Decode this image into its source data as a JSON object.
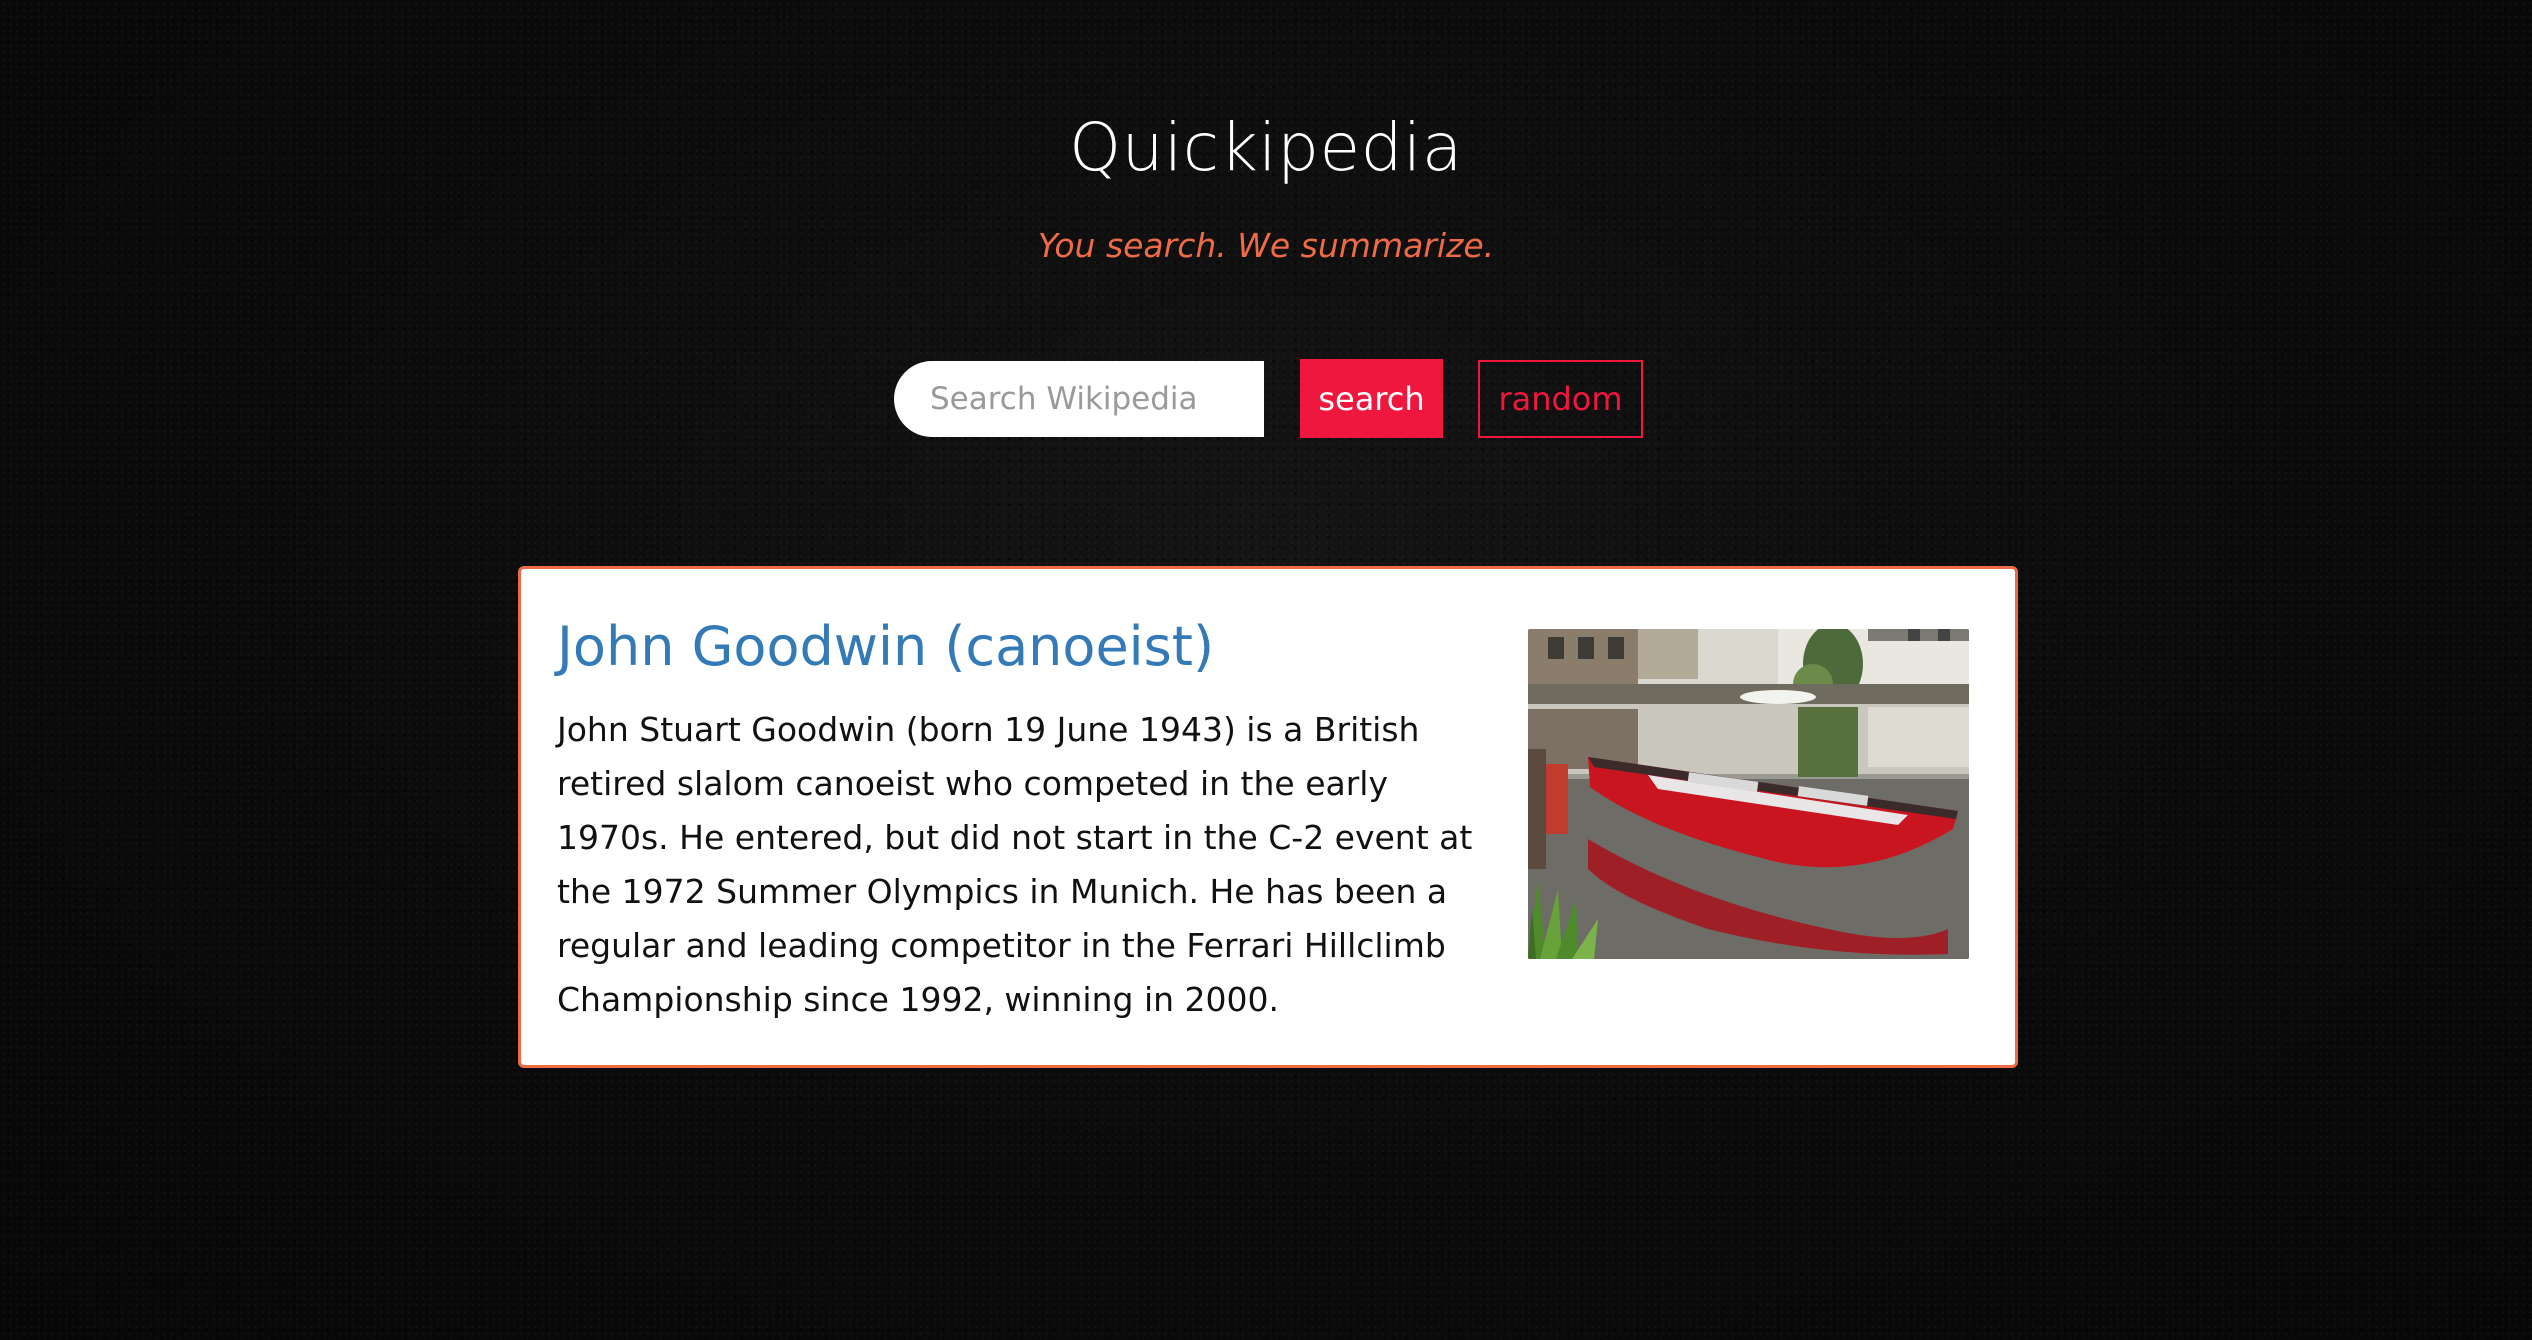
{
  "header": {
    "title": "Quickipedia",
    "tagline": "You search. We summarize."
  },
  "search": {
    "placeholder": "Search Wikipedia",
    "value": "",
    "search_label": "search",
    "random_label": "random"
  },
  "result": {
    "title": "John Goodwin (canoeist)",
    "summary": "John Stuart Goodwin (born 19 June 1943) is a British retired slalom canoeist who competed in the early 1970s. He entered, but did not start in the C-2 event at the 1972 Summer Olympics in Munich. He has been a regular and leading competitor in the Ferrari Hillclimb Championship since 1992, winning in 2000.",
    "thumbnail_subject": "red canoe moored on canal"
  },
  "colors": {
    "background": "#0a0a0a",
    "accent": "#f0173f",
    "tagline": "#ef6a47",
    "card_border": "#ef6a47",
    "link": "#337ab7"
  }
}
